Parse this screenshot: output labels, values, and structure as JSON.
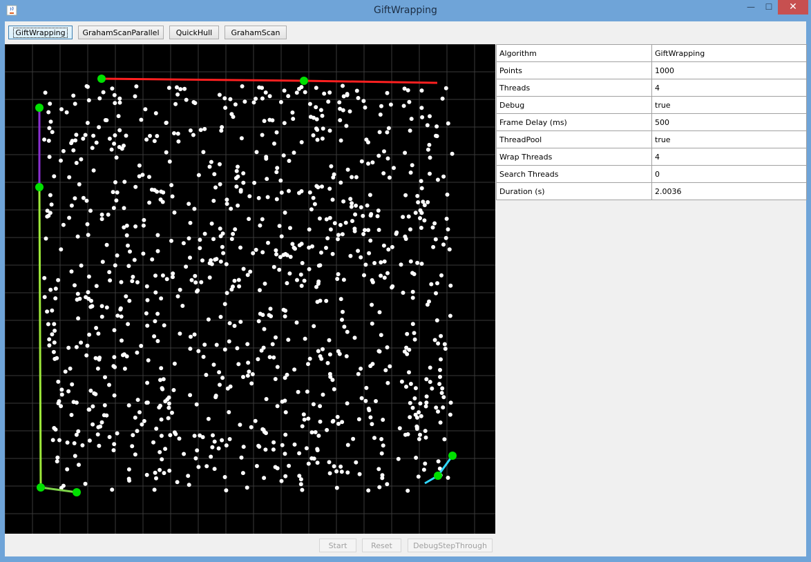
{
  "window": {
    "title": "GiftWrapping"
  },
  "toolbar": {
    "buttons": [
      "GiftWrapping",
      "GrahamScanParallel",
      "QuickHull",
      "GrahamScan"
    ]
  },
  "properties": [
    {
      "key": "Algorithm",
      "value": "GiftWrapping"
    },
    {
      "key": "Points",
      "value": "1000"
    },
    {
      "key": "Threads",
      "value": "4"
    },
    {
      "key": "Debug",
      "value": "true"
    },
    {
      "key": "Frame Delay (ms)",
      "value": "500"
    },
    {
      "key": "ThreadPool",
      "value": "true"
    },
    {
      "key": "Wrap Threads",
      "value": "4"
    },
    {
      "key": "Search Threads",
      "value": "0"
    },
    {
      "key": "Duration (s)",
      "value": "2.0036"
    }
  ],
  "controls": {
    "start_label": "Start",
    "reset_label": "Reset",
    "debug_label": "DebugStepThrough"
  },
  "colors": {
    "canvas_background": "#000000",
    "grid": "#3a3a3a",
    "point": "#ffffff",
    "hull_vertex": "#00e000",
    "edge_top": "#ff2020",
    "edge_left_upper": "#8a30d0",
    "edge_left": "#9de83a",
    "edge_bottom": "#7ed34a",
    "edge_right_bottom": "#30d8ff"
  }
}
